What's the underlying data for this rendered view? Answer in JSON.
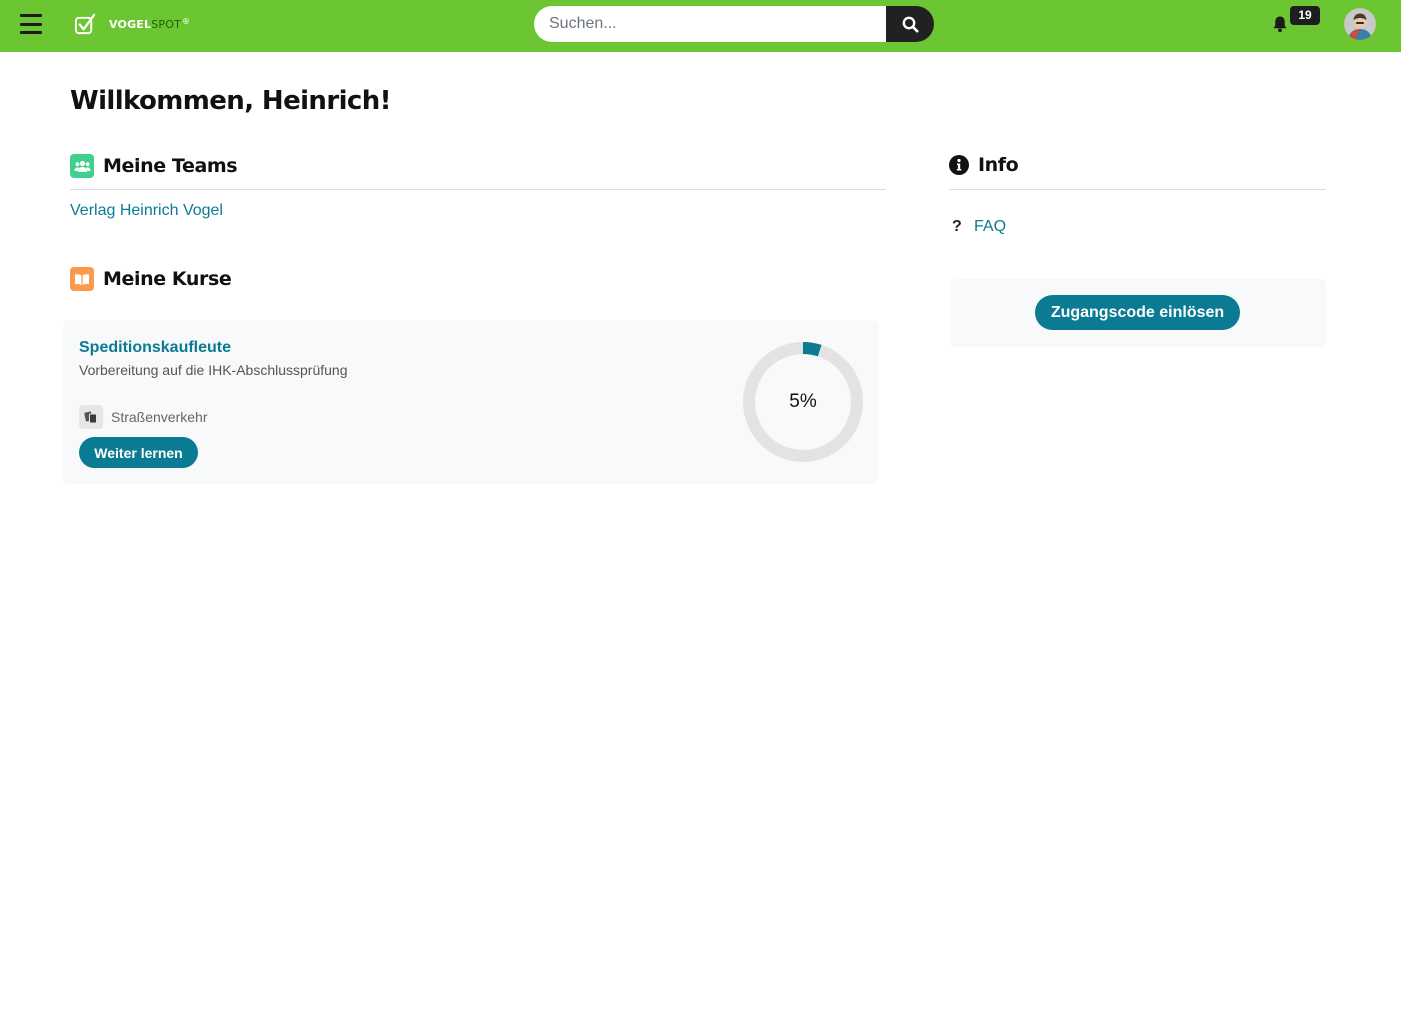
{
  "header": {
    "logo": {
      "part1": "VOGEL",
      "part2": "SPOT",
      "part3": "®"
    },
    "search": {
      "placeholder": "Suchen..."
    },
    "notifications": {
      "count": "19"
    }
  },
  "welcome": "Willkommen, Heinrich!",
  "teams": {
    "title": "Meine Teams",
    "items": [
      "Verlag Heinrich Vogel"
    ]
  },
  "courses": {
    "title": "Meine Kurse",
    "items": [
      {
        "title": "Speditionskaufleute",
        "subtitle": "Vorbereitung auf die IHK-Abschlussprüfung",
        "tag": "Straßenverkehr",
        "button": "Weiter lernen",
        "progress": 5,
        "progress_label": "5%"
      }
    ]
  },
  "info": {
    "title": "Info",
    "faq_mark": "?",
    "faq_label": "FAQ",
    "code_button": "Zugangscode einlösen"
  },
  "colors": {
    "header_bg": "#6cc631",
    "accent": "#0b7a93",
    "teams_icon": "#3fd08b",
    "courses_icon": "#fb9a4b",
    "progress_track": "#e3e3e3"
  }
}
